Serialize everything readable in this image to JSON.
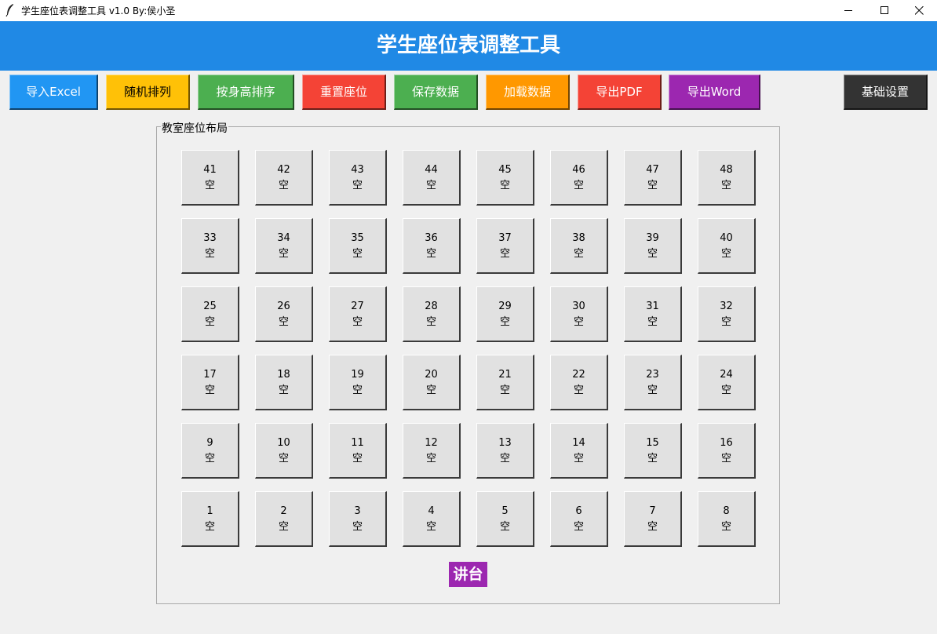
{
  "window": {
    "title": "学生座位表调整工具 v1.0 By:侯小圣",
    "icon": "feather-icon",
    "controls": [
      "minimize-icon",
      "maximize-icon",
      "close-icon"
    ]
  },
  "header": {
    "title": "学生座位表调整工具",
    "color": "#2089e5"
  },
  "toolbar": [
    {
      "id": "import-excel",
      "label": "导入Excel",
      "bg": "#2196f3",
      "fg": "#ffffff"
    },
    {
      "id": "random-arrange",
      "label": "随机排列",
      "bg": "#ffc107",
      "fg": "#000000"
    },
    {
      "id": "sort-by-height",
      "label": "按身高排序",
      "bg": "#4caf50",
      "fg": "#ffffff"
    },
    {
      "id": "reset-seats",
      "label": "重置座位",
      "bg": "#f44336",
      "fg": "#ffffff"
    },
    {
      "id": "save-data",
      "label": "保存数据",
      "bg": "#4caf50",
      "fg": "#ffffff"
    },
    {
      "id": "load-data",
      "label": "加载数据",
      "bg": "#ff9800",
      "fg": "#ffffff"
    },
    {
      "id": "export-pdf",
      "label": "导出PDF",
      "bg": "#f44336",
      "fg": "#ffffff"
    },
    {
      "id": "export-word",
      "label": "导出Word",
      "bg": "#9c27b0",
      "fg": "#ffffff"
    },
    {
      "id": "basic-settings",
      "label": "基础设置",
      "bg": "#333333",
      "fg": "#ffffff"
    }
  ],
  "classroom": {
    "title": "教室座位布局",
    "rows": [
      [
        {
          "num": "41",
          "status": "空"
        },
        {
          "num": "42",
          "status": "空"
        },
        {
          "num": "43",
          "status": "空"
        },
        {
          "num": "44",
          "status": "空"
        },
        {
          "num": "45",
          "status": "空"
        },
        {
          "num": "46",
          "status": "空"
        },
        {
          "num": "47",
          "status": "空"
        },
        {
          "num": "48",
          "status": "空"
        }
      ],
      [
        {
          "num": "33",
          "status": "空"
        },
        {
          "num": "34",
          "status": "空"
        },
        {
          "num": "35",
          "status": "空"
        },
        {
          "num": "36",
          "status": "空"
        },
        {
          "num": "37",
          "status": "空"
        },
        {
          "num": "38",
          "status": "空"
        },
        {
          "num": "39",
          "status": "空"
        },
        {
          "num": "40",
          "status": "空"
        }
      ],
      [
        {
          "num": "25",
          "status": "空"
        },
        {
          "num": "26",
          "status": "空"
        },
        {
          "num": "27",
          "status": "空"
        },
        {
          "num": "28",
          "status": "空"
        },
        {
          "num": "29",
          "status": "空"
        },
        {
          "num": "30",
          "status": "空"
        },
        {
          "num": "31",
          "status": "空"
        },
        {
          "num": "32",
          "status": "空"
        }
      ],
      [
        {
          "num": "17",
          "status": "空"
        },
        {
          "num": "18",
          "status": "空"
        },
        {
          "num": "19",
          "status": "空"
        },
        {
          "num": "20",
          "status": "空"
        },
        {
          "num": "21",
          "status": "空"
        },
        {
          "num": "22",
          "status": "空"
        },
        {
          "num": "23",
          "status": "空"
        },
        {
          "num": "24",
          "status": "空"
        }
      ],
      [
        {
          "num": "9",
          "status": "空"
        },
        {
          "num": "10",
          "status": "空"
        },
        {
          "num": "11",
          "status": "空"
        },
        {
          "num": "12",
          "status": "空"
        },
        {
          "num": "13",
          "status": "空"
        },
        {
          "num": "14",
          "status": "空"
        },
        {
          "num": "15",
          "status": "空"
        },
        {
          "num": "16",
          "status": "空"
        }
      ],
      [
        {
          "num": "1",
          "status": "空"
        },
        {
          "num": "2",
          "status": "空"
        },
        {
          "num": "3",
          "status": "空"
        },
        {
          "num": "4",
          "status": "空"
        },
        {
          "num": "5",
          "status": "空"
        },
        {
          "num": "6",
          "status": "空"
        },
        {
          "num": "7",
          "status": "空"
        },
        {
          "num": "8",
          "status": "空"
        }
      ]
    ],
    "podium_label": "讲台",
    "podium_color": "#9c27b0"
  }
}
